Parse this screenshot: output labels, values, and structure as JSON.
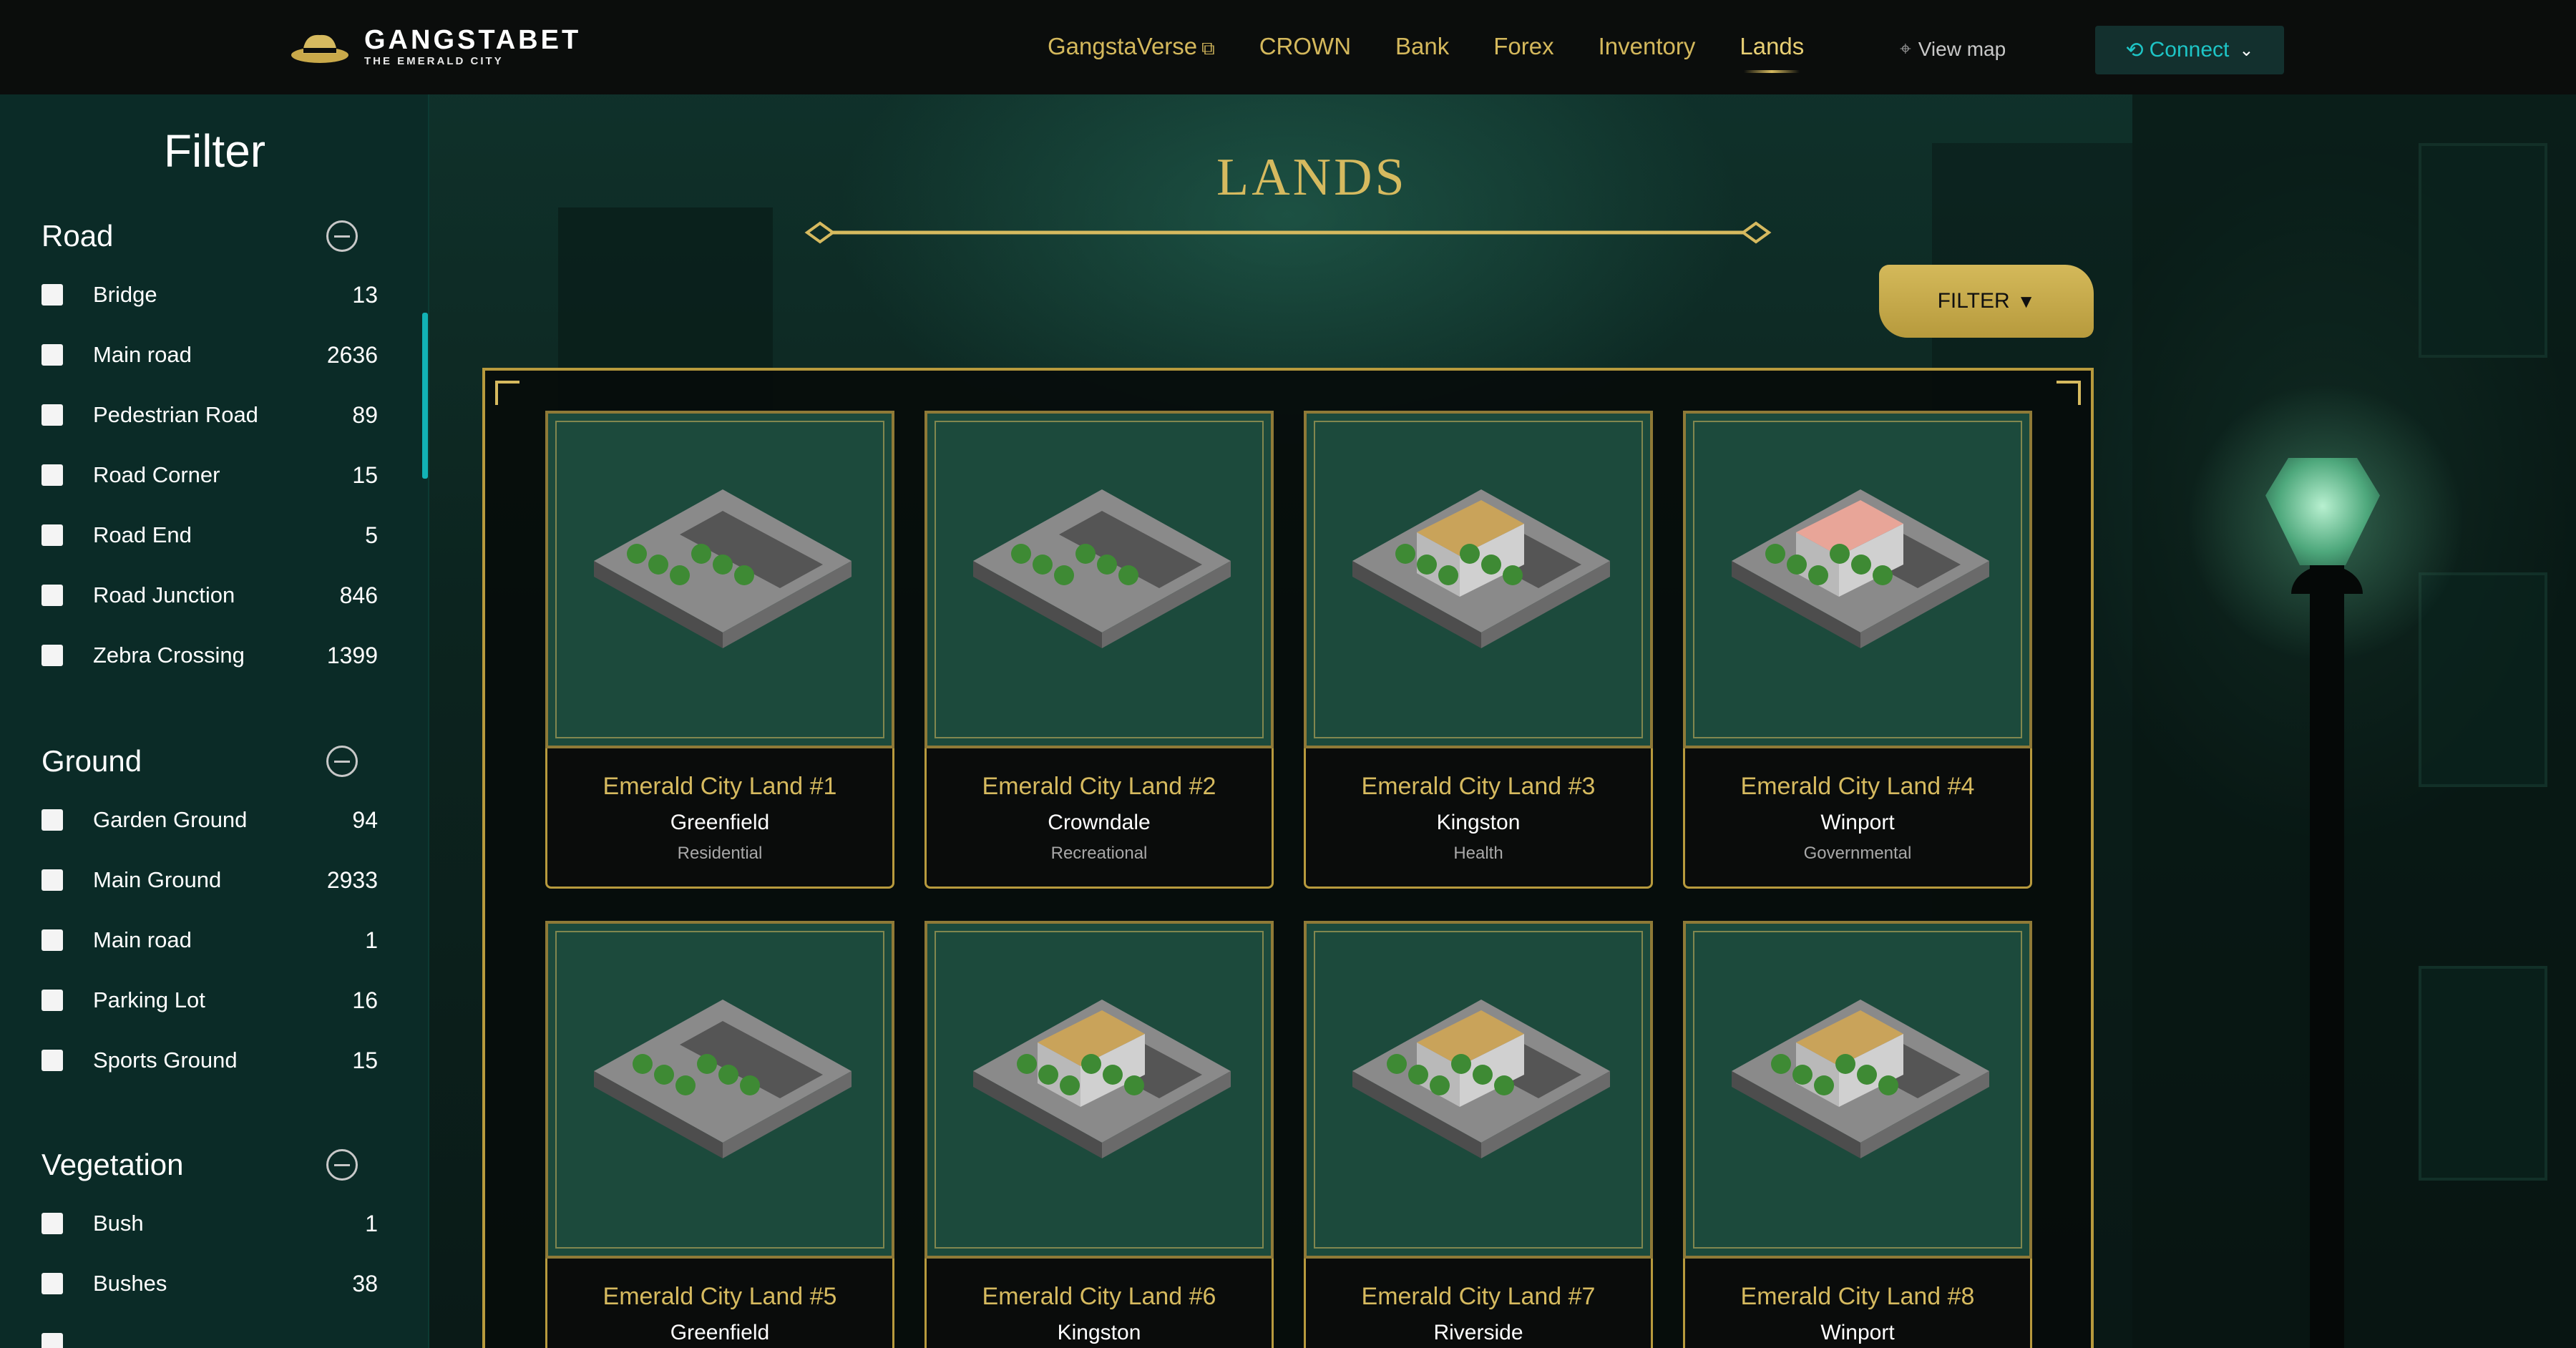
{
  "brand": {
    "title": "GANGSTABET",
    "subtitle": "THE EMERALD CITY"
  },
  "nav": {
    "items": [
      {
        "label": "GangstaVerse",
        "external_icon": "external-link-icon"
      },
      {
        "label": "CROWN"
      },
      {
        "label": "Bank"
      },
      {
        "label": "Forex"
      },
      {
        "label": "Inventory"
      },
      {
        "label": "Lands",
        "active": true
      }
    ],
    "view_map": "View map",
    "connect": "Connect"
  },
  "sidebar": {
    "title": "Filter",
    "groups": [
      {
        "title": "Road",
        "options": [
          {
            "label": "Bridge",
            "count": "13"
          },
          {
            "label": "Main road",
            "count": "2636"
          },
          {
            "label": "Pedestrian Road",
            "count": "89"
          },
          {
            "label": "Road Corner",
            "count": "15"
          },
          {
            "label": "Road End",
            "count": "5"
          },
          {
            "label": "Road Junction",
            "count": "846"
          },
          {
            "label": "Zebra Crossing",
            "count": "1399"
          }
        ]
      },
      {
        "title": "Ground",
        "options": [
          {
            "label": "Garden Ground",
            "count": "94"
          },
          {
            "label": "Main Ground",
            "count": "2933"
          },
          {
            "label": "Main road",
            "count": "1"
          },
          {
            "label": "Parking Lot",
            "count": "16"
          },
          {
            "label": "Sports Ground",
            "count": "15"
          }
        ]
      },
      {
        "title": "Vegetation",
        "options": [
          {
            "label": "Bush",
            "count": "1"
          },
          {
            "label": "Bushes",
            "count": "38"
          }
        ]
      }
    ]
  },
  "main": {
    "title": "LANDS",
    "filter_button": "FILTER",
    "cards": [
      {
        "name": "Emerald City Land #1",
        "district": "Greenfield",
        "type": "Residential"
      },
      {
        "name": "Emerald City Land #2",
        "district": "Crowndale",
        "type": "Recreational"
      },
      {
        "name": "Emerald City Land #3",
        "district": "Kingston",
        "type": "Health"
      },
      {
        "name": "Emerald City Land #4",
        "district": "Winport",
        "type": "Governmental"
      },
      {
        "name": "Emerald City Land #5",
        "district": "Greenfield",
        "type": ""
      },
      {
        "name": "Emerald City Land #6",
        "district": "Kingston",
        "type": ""
      },
      {
        "name": "Emerald City Land #7",
        "district": "Riverside",
        "type": ""
      },
      {
        "name": "Emerald City Land #8",
        "district": "Winport",
        "type": ""
      }
    ]
  },
  "colors": {
    "gold": "#d6ba5f",
    "teal_accent": "#1ec5c6",
    "sidebar_bg": "#0b2b27",
    "card_bg": "#1c4a3c"
  }
}
